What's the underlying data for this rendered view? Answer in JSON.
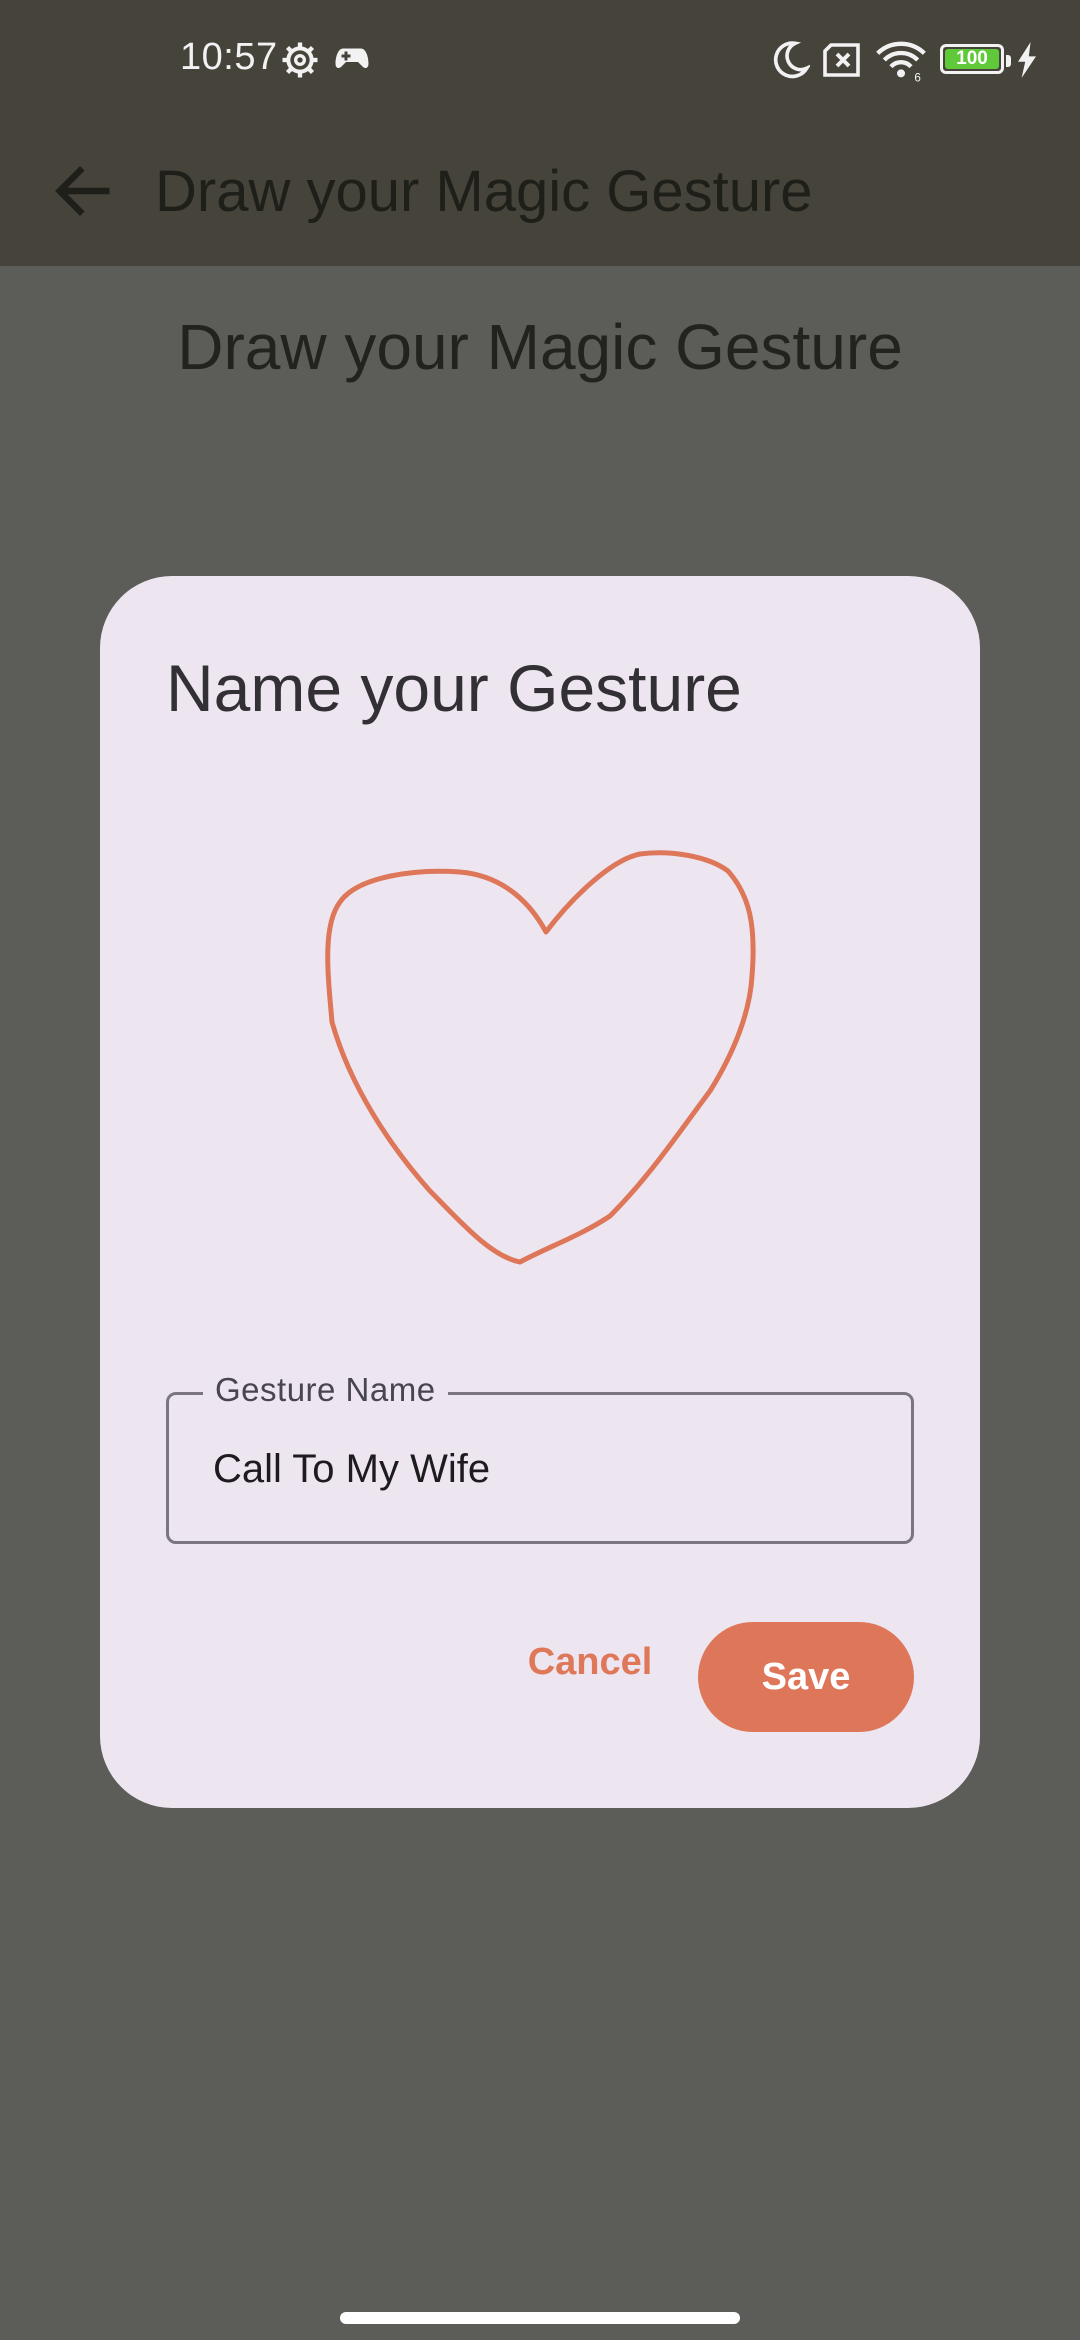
{
  "status_bar": {
    "time": "10:57",
    "battery": "100",
    "icons": [
      "settings-gear-icon",
      "gamepad-icon",
      "moon-icon",
      "sim-x-icon",
      "wifi-icon",
      "battery-icon",
      "charging-bolt-icon"
    ]
  },
  "app_bar": {
    "title": "Draw your Magic Gesture",
    "back_icon": "arrow-left-icon"
  },
  "page": {
    "heading": "Draw your Magic Gesture"
  },
  "dialog": {
    "title": "Name your Gesture",
    "gesture_shape": "heart",
    "field_label": "Gesture Name",
    "field_value": "Call To My Wife",
    "cancel_label": "Cancel",
    "save_label": "Save"
  },
  "colors": {
    "accent": "#de7759",
    "dialog_bg": "#ede6f1",
    "scrim_bg": "#5c5d58",
    "appbar_bg": "#45433a"
  }
}
